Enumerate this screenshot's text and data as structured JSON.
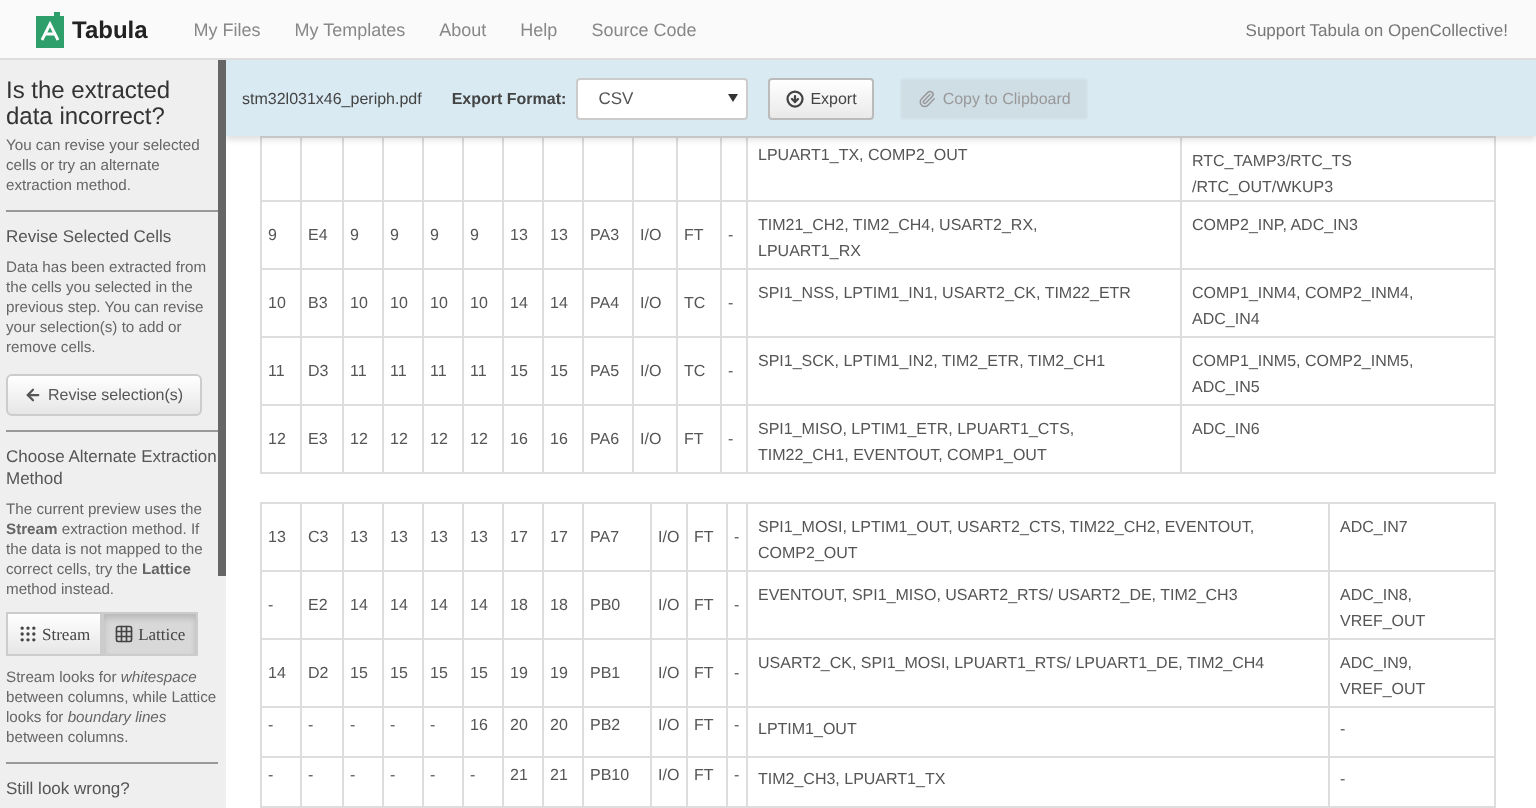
{
  "navbar": {
    "brand": "Tabula",
    "links": [
      "My Files",
      "My Templates",
      "About",
      "Help",
      "Source Code"
    ],
    "support": "Support Tabula on OpenCollective!"
  },
  "sidebar": {
    "title": "Is the extracted data incorrect?",
    "intro": "You can revise your selected cells or try an alternate extraction method.",
    "revise": {
      "heading": "Revise Selected Cells",
      "text": "Data has been extracted from the cells you selected in the previous step. You can revise your selection(s) to add or remove cells.",
      "button": "Revise selection(s)"
    },
    "alternate": {
      "heading": "Choose Alternate Extraction Method",
      "text": "The current preview uses the **Stream** extraction method. If the data is not mapped to the correct cells, try the **Lattice** method instead.",
      "methods": [
        {
          "label": "Stream",
          "kind": "stream",
          "selected": false
        },
        {
          "label": "Lattice",
          "kind": "lattice",
          "selected": true
        }
      ],
      "note": "Stream looks for *whitespace* between columns, while Lattice looks for *boundary lines* between columns."
    },
    "footer": "Still look wrong?"
  },
  "export_bar": {
    "filename": "stm32l031x46_periph.pdf",
    "format_label": "Export Format:",
    "format": "CSV",
    "export_button": "Export",
    "copy_button": {
      "label": "Copy to Clipboard",
      "disabled": true
    }
  },
  "tables": [
    {
      "rows": [
        {
          "kind": "partial",
          "cells": [],
          "alt": [
            "LPUART1_TX, COMP2_OUT"
          ],
          "analog": [
            "RTC_TAMP3/RTC_TS",
            "/RTC_OUT/WKUP3"
          ]
        },
        {
          "kind": "full",
          "cells": [
            "9",
            "E4",
            "9",
            "9",
            "9",
            "9",
            "13",
            "13",
            "PA3",
            "I/O",
            "FT",
            "-"
          ],
          "alt": [
            "TIM21_CH2, TIM2_CH4, USART2_RX,",
            "LPUART1_RX"
          ],
          "analog": [
            "COMP2_INP, ADC_IN3"
          ]
        },
        {
          "kind": "full",
          "cells": [
            "10",
            "B3",
            "10",
            "10",
            "10",
            "10",
            "14",
            "14",
            "PA4",
            "I/O",
            "TC",
            "-"
          ],
          "alt": [
            "SPI1_NSS, LPTIM1_IN1, USART2_CK, TIM22_ETR"
          ],
          "analog": [
            "COMP1_INM4, COMP2_INM4,",
            "ADC_IN4"
          ]
        },
        {
          "kind": "full",
          "cells": [
            "11",
            "D3",
            "11",
            "11",
            "11",
            "11",
            "15",
            "15",
            "PA5",
            "I/O",
            "TC",
            "-"
          ],
          "alt": [
            "SPI1_SCK, LPTIM1_IN2, TIM2_ETR, TIM2_CH1"
          ],
          "analog": [
            "COMP1_INM5, COMP2_INM5,",
            "ADC_IN5"
          ]
        },
        {
          "kind": "full",
          "cells": [
            "12",
            "E3",
            "12",
            "12",
            "12",
            "12",
            "16",
            "16",
            "PA6",
            "I/O",
            "FT",
            "-"
          ],
          "alt": [
            "SPI1_MISO, LPTIM1_ETR, LPUART1_CTS,",
            "TIM22_CH1, EVENTOUT, COMP1_OUT"
          ],
          "analog": [
            "ADC_IN6"
          ]
        }
      ]
    },
    {
      "rows": [
        {
          "kind": "full",
          "cells": [
            "13",
            "C3",
            "13",
            "13",
            "13",
            "13",
            "17",
            "17",
            "PA7",
            "I/O",
            "FT",
            "-"
          ],
          "alt": [
            "SPI1_MOSI, LPTIM1_OUT, USART2_CTS, TIM22_CH2, EVENTOUT,",
            "COMP2_OUT"
          ],
          "analog": [
            "ADC_IN7"
          ]
        },
        {
          "kind": "full",
          "cells": [
            "-",
            "E2",
            "14",
            "14",
            "14",
            "14",
            "18",
            "18",
            "PB0",
            "I/O",
            "FT",
            "-"
          ],
          "alt": [
            "EVENTOUT, SPI1_MISO, USART2_RTS/ USART2_DE, TIM2_CH3"
          ],
          "analog": [
            "ADC_IN8,",
            "VREF_OUT"
          ]
        },
        {
          "kind": "full",
          "cells": [
            "14",
            "D2",
            "15",
            "15",
            "15",
            "15",
            "19",
            "19",
            "PB1",
            "I/O",
            "FT",
            "-"
          ],
          "alt": [
            "USART2_CK, SPI1_MOSI, LPUART1_RTS/ LPUART1_DE, TIM2_CH4"
          ],
          "analog": [
            "ADC_IN9,",
            "VREF_OUT"
          ]
        },
        {
          "kind": "short",
          "cells": [
            "-",
            "-",
            "-",
            "-",
            "-",
            "16",
            "20",
            "20",
            "PB2",
            "I/O",
            "FT",
            "-"
          ],
          "alt": [
            "LPTIM1_OUT"
          ],
          "analog": [
            "-"
          ]
        },
        {
          "kind": "short",
          "cells": [
            "-",
            "-",
            "-",
            "-",
            "-",
            "-",
            "21",
            "21",
            "PB10",
            "I/O",
            "FT",
            "-"
          ],
          "alt": [
            "TIM2_CH3, LPUART1_TX"
          ],
          "analog": [
            "-"
          ]
        }
      ]
    }
  ]
}
